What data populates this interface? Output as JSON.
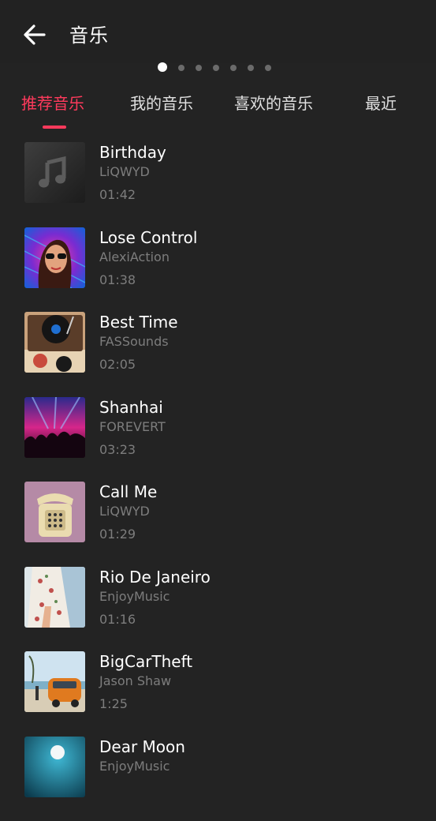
{
  "header": {
    "title": "音乐"
  },
  "pager": {
    "count": 7,
    "active": 0
  },
  "tabs": [
    {
      "label": "推荐音乐",
      "active": true
    },
    {
      "label": "我的音乐",
      "active": false
    },
    {
      "label": "喜欢的音乐",
      "active": false
    },
    {
      "label": "最近",
      "active": false
    }
  ],
  "songs": [
    {
      "title": "Birthday",
      "artist": "LiQWYD",
      "duration": "01:42",
      "cover": "music-note-placeholder"
    },
    {
      "title": "Lose Control",
      "artist": "AlexiAction",
      "duration": "01:38",
      "cover": "woman-sunglasses-neon"
    },
    {
      "title": "Best Time",
      "artist": "FASSounds",
      "duration": "02:05",
      "cover": "record-player"
    },
    {
      "title": "Shanhai",
      "artist": "FOREVERT",
      "duration": "03:23",
      "cover": "concert-crowd"
    },
    {
      "title": "Call Me",
      "artist": "LiQWYD",
      "duration": "01:29",
      "cover": "retro-telephone"
    },
    {
      "title": "Rio De Janeiro",
      "artist": "EnjoyMusic",
      "duration": "01:16",
      "cover": "floral-dress"
    },
    {
      "title": "BigCarTheft",
      "artist": "Jason Shaw",
      "duration": "1:25",
      "cover": "orange-van-beach"
    },
    {
      "title": "Dear Moon",
      "artist": "EnjoyMusic",
      "duration": "",
      "cover": "moon-ocean"
    }
  ],
  "colors": {
    "accent": "#ff3a5c",
    "background": "#232323",
    "secondary_text": "#7d7d7d"
  }
}
